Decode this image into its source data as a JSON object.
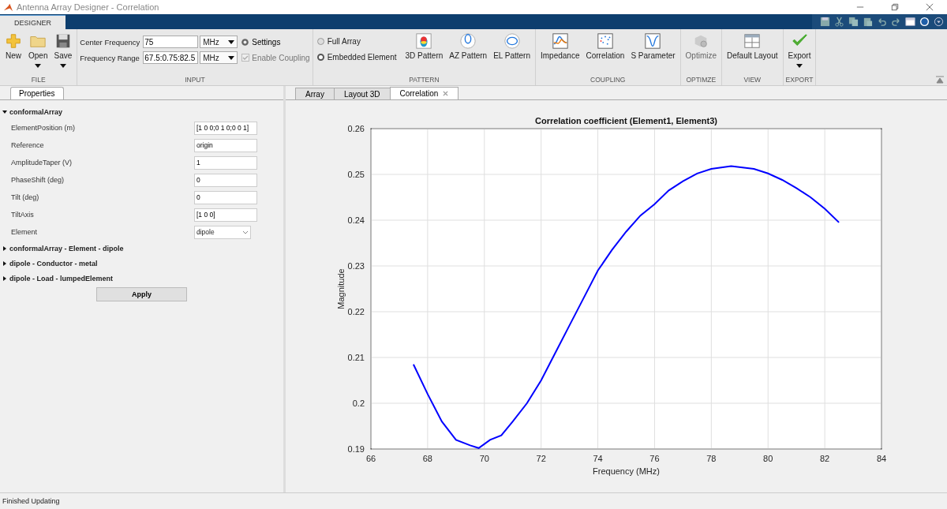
{
  "window": {
    "title": "Antenna Array Designer - Correlation"
  },
  "ribbon": {
    "tabs": [
      {
        "label": "DESIGNER",
        "selected": true
      }
    ],
    "file": {
      "label": "FILE",
      "buttons": [
        {
          "kind": "new",
          "label": "New",
          "dropdown": false
        },
        {
          "kind": "open",
          "label": "Open",
          "dropdown": true
        },
        {
          "kind": "save",
          "label": "Save",
          "dropdown": true
        }
      ]
    },
    "input": {
      "label": "INPUT",
      "center_frequency": {
        "label": "Center Frequency",
        "value": "75",
        "unit": "MHz"
      },
      "frequency_range": {
        "label": "Frequency Range",
        "value": "67.5:0.75:82.5",
        "unit": "MHz"
      },
      "settings": {
        "label": "Settings"
      },
      "enable_coupling": {
        "label": "Enable Coupling",
        "checked": true,
        "disabled": true
      }
    },
    "pattern": {
      "label": "PATTERN",
      "radios": [
        {
          "label": "Full Array",
          "selected": false
        },
        {
          "label": "Embedded Element",
          "selected": true
        }
      ],
      "buttons": [
        {
          "kind": "pattern3d",
          "label": "3D Pattern"
        },
        {
          "kind": "azimuth",
          "label": "AZ Pattern"
        },
        {
          "kind": "elevation",
          "label": "EL Pattern"
        }
      ]
    },
    "coupling": {
      "label": "COUPLING",
      "buttons": [
        {
          "kind": "impedance",
          "label": "Impedance"
        },
        {
          "kind": "correlation",
          "label": "Correlation"
        },
        {
          "kind": "sparameter",
          "label": "S Parameter"
        }
      ]
    },
    "optimize": {
      "label": "OPTIMZE",
      "buttons": [
        {
          "kind": "optimize",
          "label": "Optimize",
          "disabled": true
        }
      ]
    },
    "view": {
      "label": "VIEW",
      "buttons": [
        {
          "kind": "layout",
          "label": "Default Layout"
        }
      ]
    },
    "export": {
      "label": "EXPORT",
      "buttons": [
        {
          "kind": "export",
          "label": "Export",
          "dropdown": true
        }
      ]
    }
  },
  "properties_panel": {
    "tab": "Properties",
    "sections": [
      {
        "label": "conformalArray",
        "expanded": true,
        "properties": [
          {
            "kind": "text",
            "label": "ElementPosition (m)",
            "value": "[1 0 0;0 1 0;0 0 1]"
          },
          {
            "kind": "text",
            "label": "Reference",
            "value": "origin"
          },
          {
            "kind": "text",
            "label": "AmplitudeTaper (V)",
            "value": "1"
          },
          {
            "kind": "text",
            "label": "PhaseShift (deg)",
            "value": "0"
          },
          {
            "kind": "text",
            "label": "Tilt (deg)",
            "value": "0"
          },
          {
            "kind": "text",
            "label": "TiltAxis",
            "value": "[1 0 0]"
          },
          {
            "kind": "select",
            "label": "Element",
            "value": "dipole"
          }
        ]
      },
      {
        "label": "conformalArray - Element - dipole",
        "expanded": false
      },
      {
        "label": "dipole - Conductor - metal",
        "expanded": false
      },
      {
        "label": "dipole - Load - lumpedElement",
        "expanded": false
      }
    ],
    "apply_button": "Apply"
  },
  "document_tabs": [
    {
      "label": "Array",
      "selected": false,
      "closable": false
    },
    {
      "label": "Layout 3D",
      "selected": false,
      "closable": false
    },
    {
      "label": "Correlation",
      "selected": true,
      "closable": true
    }
  ],
  "plot": {
    "chart_data": {
      "type": "line",
      "title": "Correlation coefficient (Element1, Element3)",
      "xlabel": "Frequency (MHz)",
      "ylabel": "Magnitude",
      "xlim": [
        66,
        84
      ],
      "ylim": [
        0.19,
        0.26
      ],
      "xticks": [
        66,
        68,
        70,
        72,
        74,
        76,
        78,
        80,
        82,
        84
      ],
      "yticks": [
        {
          "value": 0.19,
          "label": "0.19"
        },
        {
          "value": 0.2,
          "label": "0.2"
        },
        {
          "value": 0.21,
          "label": "0.21"
        },
        {
          "value": 0.22,
          "label": "0.22"
        },
        {
          "value": 0.23,
          "label": "0.23"
        },
        {
          "value": 0.24,
          "label": "0.24"
        },
        {
          "value": 0.25,
          "label": "0.25"
        },
        {
          "value": 0.26,
          "label": "0.26"
        }
      ],
      "x": [
        67.5,
        68,
        68.5,
        69,
        69.5,
        69.8,
        70.2,
        70.6,
        71,
        71.5,
        72,
        72.5,
        73,
        73.5,
        74,
        74.5,
        75,
        75.5,
        76,
        76.5,
        77,
        77.5,
        78,
        78.7,
        79.5,
        80,
        80.5,
        81,
        81.5,
        82,
        82.5
      ],
      "grid": true,
      "series": [
        {
          "color": "#0000ff",
          "values": [
            0.2085,
            0.202,
            0.196,
            0.192,
            0.1908,
            0.1902,
            0.192,
            0.193,
            0.196,
            0.2,
            0.205,
            0.211,
            0.217,
            0.223,
            0.229,
            0.2335,
            0.2375,
            0.241,
            0.2435,
            0.2465,
            0.2485,
            0.2502,
            0.2512,
            0.2518,
            0.2512,
            0.2502,
            0.2488,
            0.247,
            0.245,
            0.2425,
            0.2395
          ]
        }
      ]
    }
  },
  "status_bar": {
    "text": "Finished Updating"
  }
}
